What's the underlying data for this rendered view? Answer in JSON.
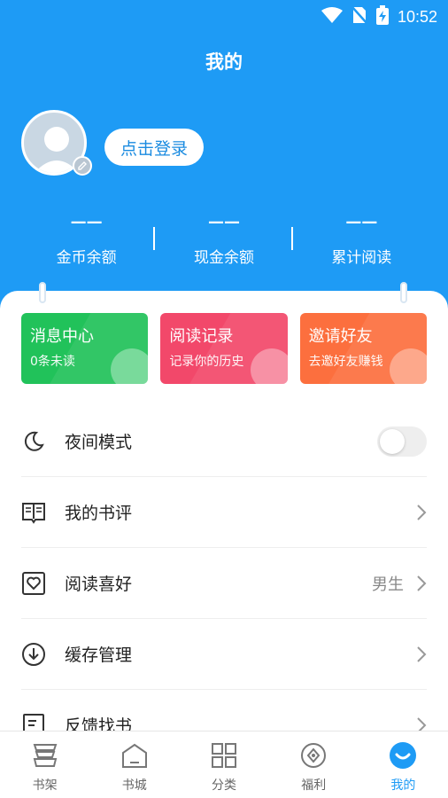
{
  "status_bar": {
    "time": "10:52"
  },
  "header": {
    "title": "我的",
    "login_label": "点击登录"
  },
  "stats": [
    {
      "value": "——",
      "label": "金币余额"
    },
    {
      "value": "——",
      "label": "现金余额"
    },
    {
      "value": "——",
      "label": "累计阅读"
    }
  ],
  "quick_cards": [
    {
      "title": "消息中心",
      "subtitle": "0条未读"
    },
    {
      "title": "阅读记录",
      "subtitle": "记录你的历史"
    },
    {
      "title": "邀请好友",
      "subtitle": "去邀好友赚钱"
    }
  ],
  "menu": [
    {
      "label": "夜间模式",
      "icon": "moon-icon"
    },
    {
      "label": "我的书评",
      "icon": "book-review-icon"
    },
    {
      "label": "阅读喜好",
      "icon": "heart-frame-icon",
      "value": "男生"
    },
    {
      "label": "缓存管理",
      "icon": "download-circle-icon"
    },
    {
      "label": "反馈找书",
      "icon": "feedback-doc-icon"
    }
  ],
  "tabs": [
    {
      "label": "书架",
      "icon": "bookshelf-icon"
    },
    {
      "label": "书城",
      "icon": "bookstore-icon"
    },
    {
      "label": "分类",
      "icon": "category-grid-icon"
    },
    {
      "label": "福利",
      "icon": "welfare-icon"
    },
    {
      "label": "我的",
      "icon": "profile-face-icon",
      "active": true
    }
  ],
  "colors": {
    "primary": "#1e9bf5",
    "message_card": "#21c25a",
    "history_card": "#f2486a",
    "invite_card": "#fc6f3e"
  }
}
